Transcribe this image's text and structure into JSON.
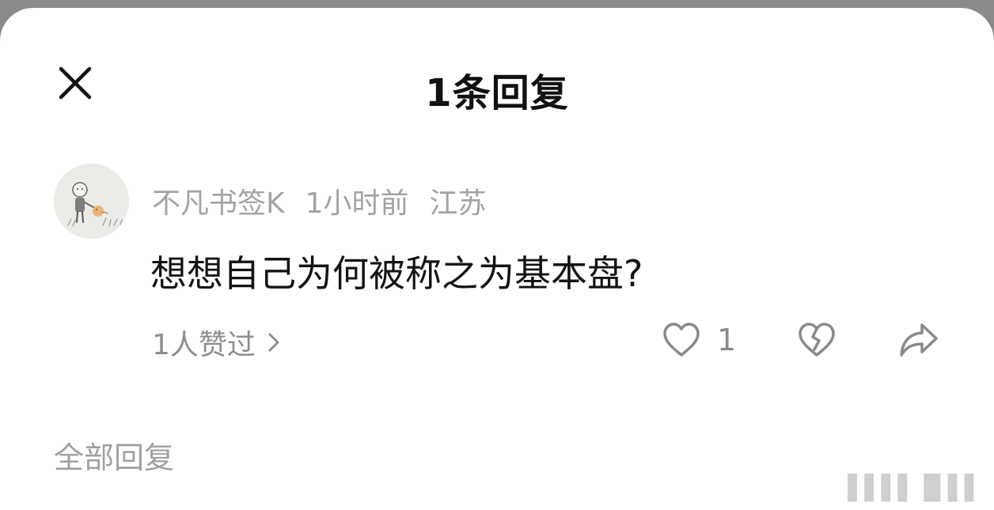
{
  "header": {
    "title": "1条回复",
    "close_icon": "close-icon"
  },
  "comment": {
    "author": "不凡书签K",
    "time": "1小时前",
    "location": "江苏",
    "text": "想想自己为何被称之为基本盘?",
    "likers_text": "1人赞过",
    "like_count": "1",
    "icons": {
      "like": "heart-outline-icon",
      "dislike": "broken-heart-icon",
      "share": "share-arrow-icon",
      "likers_chevron": "chevron-right-icon"
    }
  },
  "section": {
    "title": "全部回复"
  },
  "colors": {
    "background": "#ffffff",
    "title_text": "#111111",
    "meta_text": "#a3a3a3",
    "icon_stroke": "#8a8a8a"
  }
}
